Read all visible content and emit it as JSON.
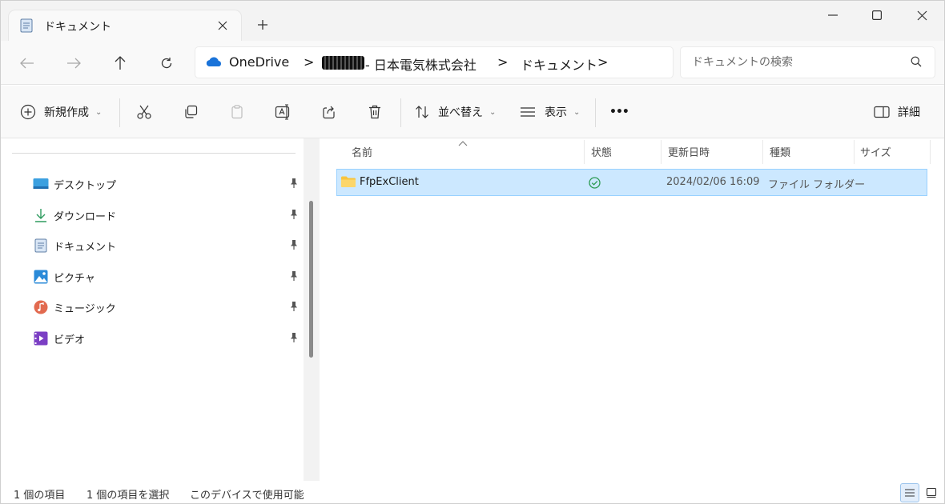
{
  "tab": {
    "title": "ドキュメント"
  },
  "window": {
    "minimize_icon": "minimize-icon",
    "maximize_icon": "maximize-icon",
    "close_icon": "close-icon"
  },
  "address": {
    "crumbs": [
      "OneDrive",
      "- 日本電気株式会社",
      "ドキュメント"
    ],
    "separator": ">"
  },
  "search": {
    "placeholder": "ドキュメントの検索",
    "value": ""
  },
  "toolbar": {
    "new_label": "新規作成",
    "sort_label": "並べ替え",
    "view_label": "表示",
    "more_label": "•••",
    "details_label": "詳細"
  },
  "sidebar": {
    "items": [
      {
        "label": "デスクトップ",
        "icon": "desktop-icon"
      },
      {
        "label": "ダウンロード",
        "icon": "download-icon"
      },
      {
        "label": "ドキュメント",
        "icon": "document-icon"
      },
      {
        "label": "ピクチャ",
        "icon": "pictures-icon"
      },
      {
        "label": "ミュージック",
        "icon": "music-icon"
      },
      {
        "label": "ビデオ",
        "icon": "video-icon"
      }
    ]
  },
  "columns": {
    "name": "名前",
    "status": "状態",
    "modified": "更新日時",
    "type": "種類",
    "size": "サイズ"
  },
  "files": [
    {
      "name": "FfpExClient",
      "status_icon": "synced-check-icon",
      "modified": "2024/02/06 16:09",
      "type": "ファイル フォルダー",
      "size": ""
    }
  ],
  "status": {
    "count": "1 個の項目",
    "selected": "1 個の項目を選択",
    "availability": "このデバイスで使用可能"
  },
  "colors": {
    "accent": "#0067c0",
    "selection": "#cce8ff",
    "selection_border": "#99d1ff",
    "folder": "#f8c43e"
  }
}
